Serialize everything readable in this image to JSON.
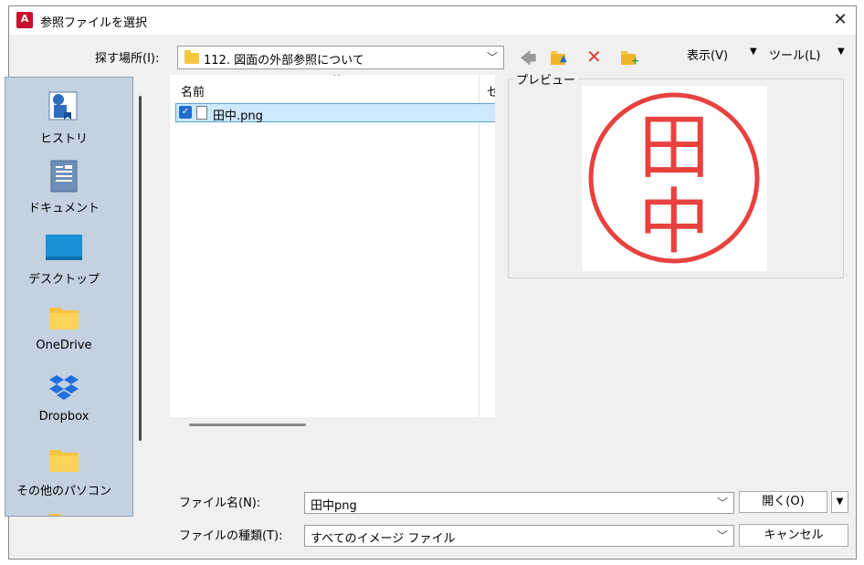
{
  "window": {
    "title": "参照ファイルを選択",
    "app_icon": "autocad-icon",
    "close_glyph": "✕"
  },
  "lookin": {
    "label": "探す場所(I):",
    "value": "112. 図面の外部参照について"
  },
  "toolbar": {
    "view_label": "表示(V)",
    "tools_label": "ツール(L)"
  },
  "places": [
    {
      "label": "ヒストリ",
      "icon": "history-icon"
    },
    {
      "label": "ドキュメント",
      "icon": "documents-icon"
    },
    {
      "label": "デスクトップ",
      "icon": "desktop-icon"
    },
    {
      "label": "OneDrive",
      "icon": "folder-icon"
    },
    {
      "label": "Dropbox",
      "icon": "dropbox-icon"
    },
    {
      "label": "その他のパソコン",
      "icon": "folder-icon"
    }
  ],
  "filelist": {
    "column_name": "名前",
    "column_partial": "セ",
    "files": [
      {
        "name": "田中.png",
        "selected": true
      }
    ]
  },
  "preview": {
    "label": "プレビュー",
    "stamp_chars": [
      "田",
      "中"
    ],
    "stamp_color": "#e8413e"
  },
  "filename": {
    "label": "ファイル名(N):",
    "value": "田中png"
  },
  "filetype": {
    "label": "ファイルの種類(T):",
    "value": "すべてのイメージ ファイル"
  },
  "buttons": {
    "open": "開く(O)",
    "cancel": "キャンセル"
  }
}
